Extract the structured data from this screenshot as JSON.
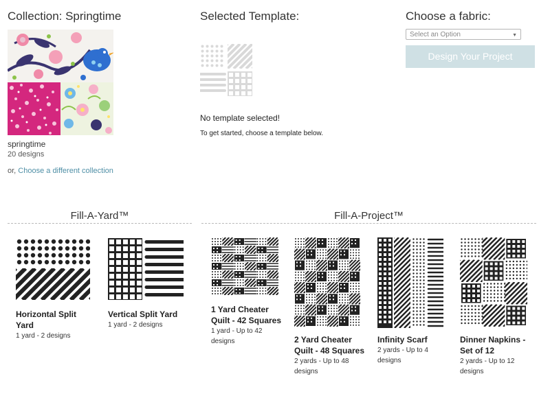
{
  "collection": {
    "heading": "Collection: Springtime",
    "name": "springtime",
    "count": "20 designs",
    "or_text": "or,",
    "change_link": "Choose a different collection"
  },
  "selected_template": {
    "heading": "Selected Template:",
    "empty_title": "No template selected!",
    "empty_hint": "To get started, choose a template below."
  },
  "fabric": {
    "heading": "Choose a fabric:",
    "select_value": "Select an Option",
    "design_button": "Design Your Project"
  },
  "fill_a_yard": {
    "title": "Fill-A-Yard™",
    "templates": [
      {
        "name": "Horizontal Split Yard",
        "desc": "1 yard - 2 designs"
      },
      {
        "name": "Vertical Split Yard",
        "desc": "1 yard - 2 designs"
      }
    ]
  },
  "fill_a_project": {
    "title": "Fill-A-Project™",
    "templates": [
      {
        "name_line1": "1 Yard Cheater",
        "name_line2": "Quilt - 42 Squares",
        "desc_line1": "1 yard - Up to 42",
        "desc_line2": "designs"
      },
      {
        "name_line1": "2 Yard Cheater",
        "name_line2": "Quilt - 48 Squares",
        "desc_line1": "2 yards - Up to 48",
        "desc_line2": "designs"
      },
      {
        "name_line1": "Infinity Scarf",
        "desc_line1": "2 yards - Up to 4",
        "desc_line2": "designs"
      },
      {
        "name_line1": "Dinner Napkins -",
        "name_line2": "Set of 12",
        "desc_line1": "2 yards - Up to 12",
        "desc_line2": "designs"
      }
    ]
  },
  "colors": {
    "accent_link": "#4f8fa6",
    "button_disabled": "#cfe0e4",
    "icon_dark": "#222222",
    "icon_placeholder": "#d9d9d9"
  }
}
